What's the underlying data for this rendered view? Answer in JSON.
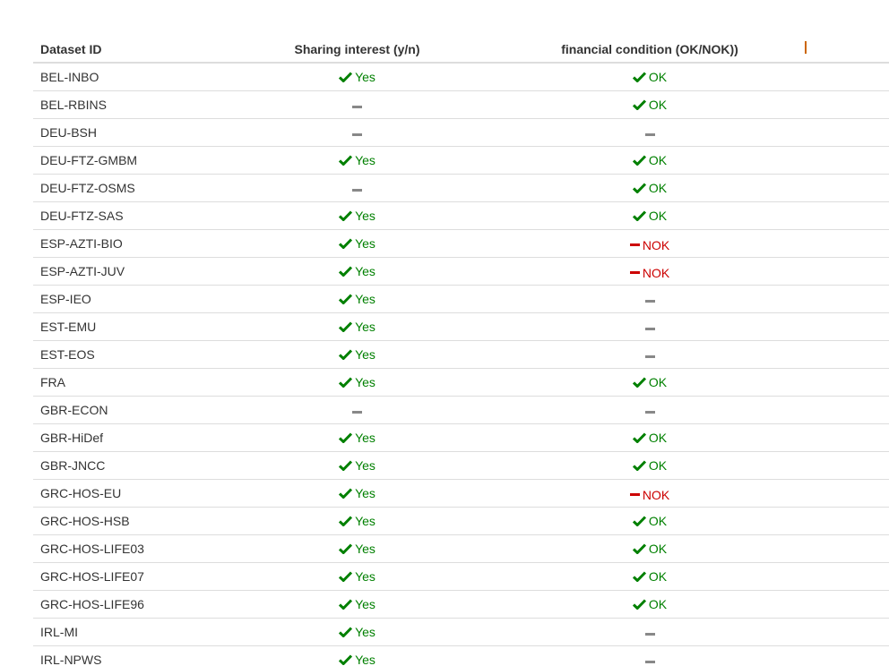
{
  "table": {
    "headers": {
      "dataset_id": "Dataset ID",
      "sharing": "Sharing interest (y/n)",
      "financial": "financial condition (OK/NOK))"
    },
    "labels": {
      "yes": "Yes",
      "ok": "OK",
      "nok": "NOK"
    },
    "colors": {
      "yes": "#008000",
      "ok": "#008000",
      "nok": "#cc0000",
      "dash": "#888888"
    },
    "rows": [
      {
        "id": "BEL-INBO",
        "sharing": "yes",
        "financial": "ok"
      },
      {
        "id": "BEL-RBINS",
        "sharing": "none",
        "financial": "ok"
      },
      {
        "id": "DEU-BSH",
        "sharing": "none",
        "financial": "none"
      },
      {
        "id": "DEU-FTZ-GMBM",
        "sharing": "yes",
        "financial": "ok"
      },
      {
        "id": "DEU-FTZ-OSMS",
        "sharing": "none",
        "financial": "ok"
      },
      {
        "id": "DEU-FTZ-SAS",
        "sharing": "yes",
        "financial": "ok"
      },
      {
        "id": "ESP-AZTI-BIO",
        "sharing": "yes",
        "financial": "nok"
      },
      {
        "id": "ESP-AZTI-JUV",
        "sharing": "yes",
        "financial": "nok"
      },
      {
        "id": "ESP-IEO",
        "sharing": "yes",
        "financial": "none"
      },
      {
        "id": "EST-EMU",
        "sharing": "yes",
        "financial": "none"
      },
      {
        "id": "EST-EOS",
        "sharing": "yes",
        "financial": "none"
      },
      {
        "id": "FRA",
        "sharing": "yes",
        "financial": "ok"
      },
      {
        "id": "GBR-ECON",
        "sharing": "none",
        "financial": "none"
      },
      {
        "id": "GBR-HiDef",
        "sharing": "yes",
        "financial": "ok"
      },
      {
        "id": "GBR-JNCC",
        "sharing": "yes",
        "financial": "ok"
      },
      {
        "id": "GRC-HOS-EU",
        "sharing": "yes",
        "financial": "nok"
      },
      {
        "id": "GRC-HOS-HSB",
        "sharing": "yes",
        "financial": "ok"
      },
      {
        "id": "GRC-HOS-LIFE03",
        "sharing": "yes",
        "financial": "ok"
      },
      {
        "id": "GRC-HOS-LIFE07",
        "sharing": "yes",
        "financial": "ok"
      },
      {
        "id": "GRC-HOS-LIFE96",
        "sharing": "yes",
        "financial": "ok"
      },
      {
        "id": "IRL-MI",
        "sharing": "yes",
        "financial": "none"
      },
      {
        "id": "IRL-NPWS",
        "sharing": "yes",
        "financial": "none"
      }
    ]
  }
}
